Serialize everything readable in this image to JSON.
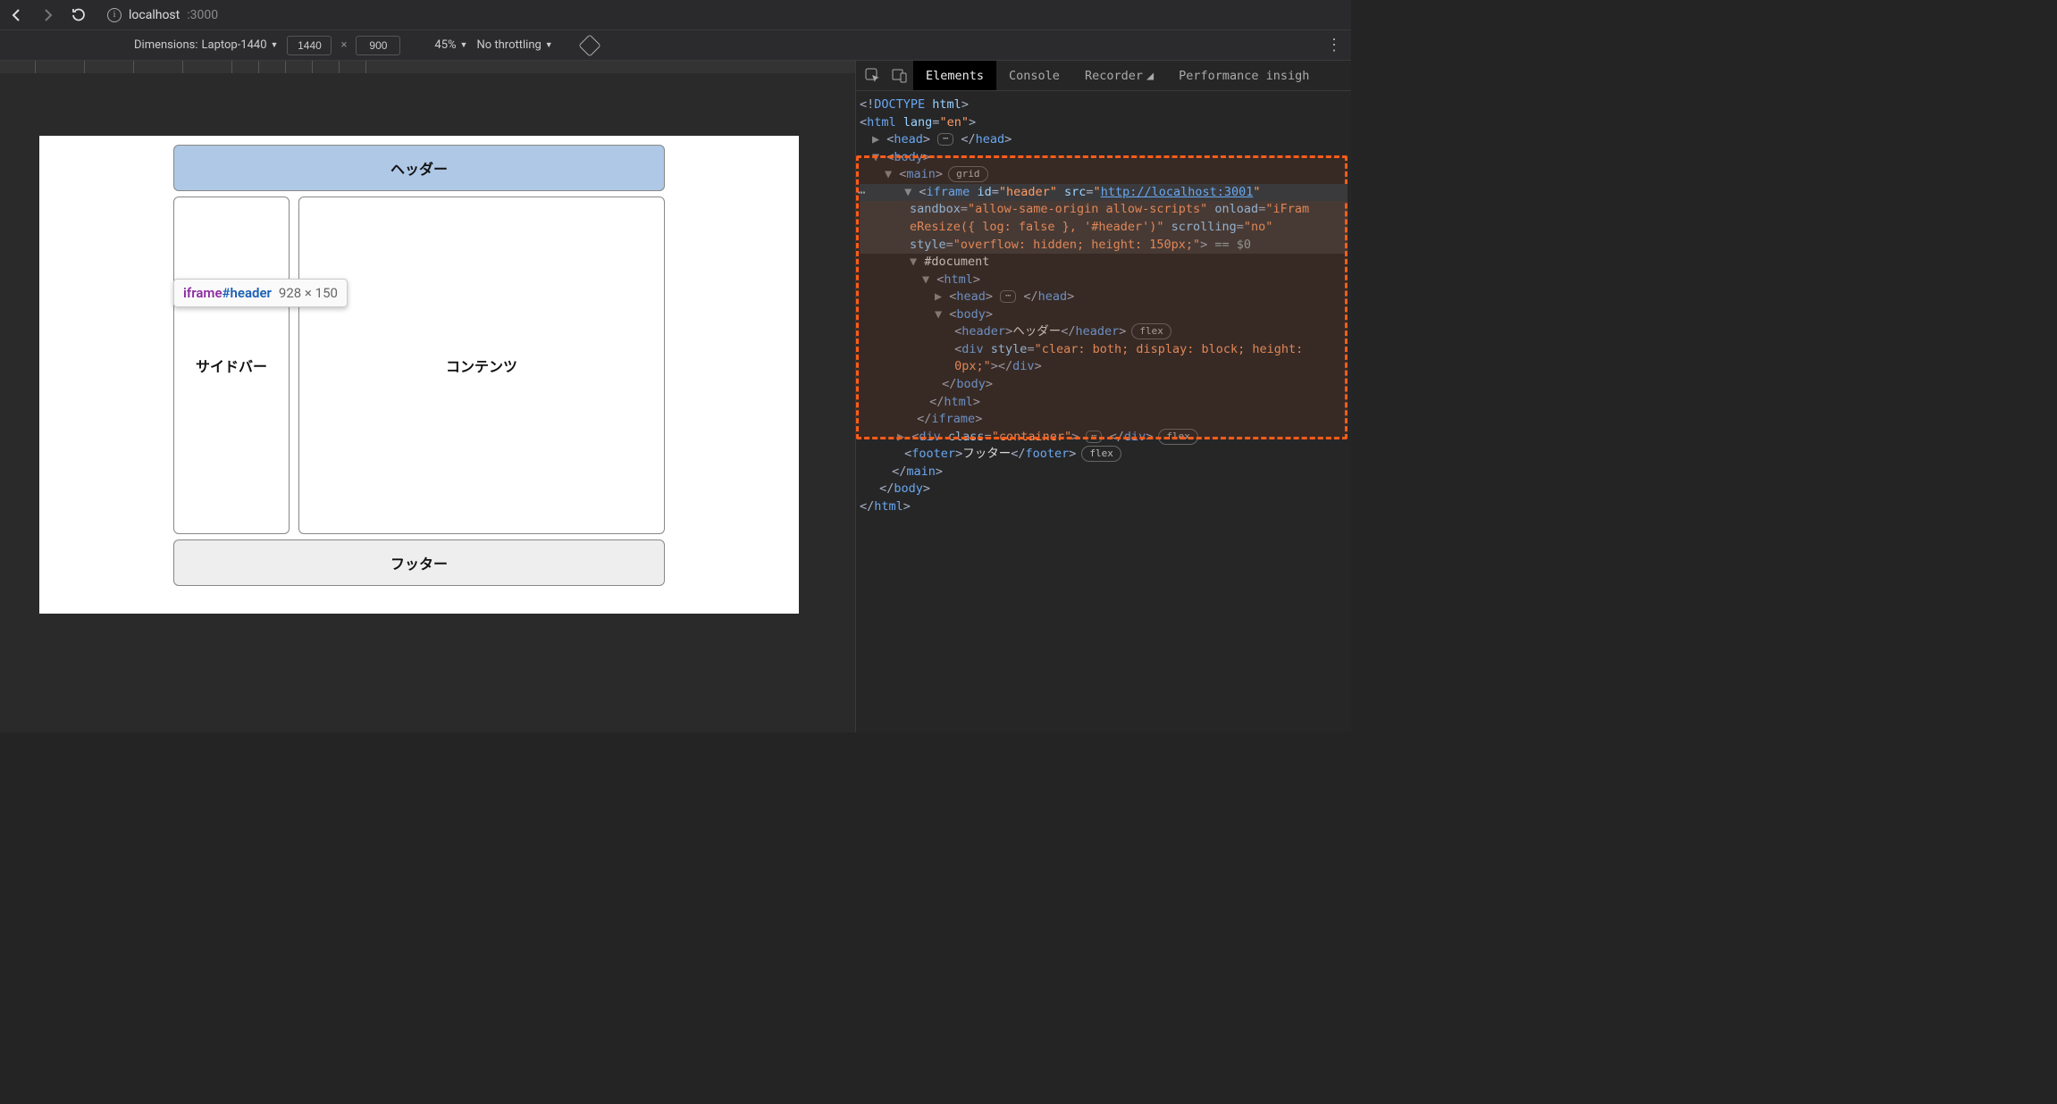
{
  "browser": {
    "url_host": "localhost",
    "url_port": ":3000"
  },
  "device_bar": {
    "dimensions_label": "Dimensions:",
    "device": "Laptop-1440",
    "width": "1440",
    "height": "900",
    "zoom": "45%",
    "throttling": "No throttling"
  },
  "page": {
    "header": "ヘッダー",
    "sidebar": "サイドバー",
    "content": "コンテンツ",
    "footer": "フッター"
  },
  "tooltip": {
    "tag": "iframe",
    "id": "#header",
    "dims": "928 × 150"
  },
  "devtools": {
    "tabs": {
      "elements": "Elements",
      "console": "Console",
      "recorder": "Recorder",
      "perf": "Performance insigh"
    },
    "dom": {
      "doctype": "<!DOCTYPE html>",
      "html_open": "<html lang=\"en\">",
      "head_collapsed": "<head> … </head>",
      "body_open": "<body>",
      "main_open": "<main>",
      "main_badge": "grid",
      "iframe_l1": "<iframe id=\"header\" src=\"",
      "iframe_src": "http://localhost:3001",
      "iframe_l1b": "\"",
      "iframe_l2": "sandbox=\"allow-same-origin allow-scripts\" onload=\"iFram",
      "iframe_l3": "eResize({ log: false }, '#header')\" scrolling=\"no\"",
      "iframe_l4": "style=\"overflow: hidden; height: 150px;\"> == $0",
      "docnode": "#document",
      "inner_html_open": "<html>",
      "inner_head": "<head> … </head>",
      "inner_body_open": "<body>",
      "inner_header": "<header>ヘッダー</header>",
      "inner_header_badge": "flex",
      "inner_div_l1": "<div style=\"clear: both; display: block; height:",
      "inner_div_l2": "0px;\"></div>",
      "inner_body_close": "</body>",
      "inner_html_close": "</html>",
      "iframe_close": "</iframe>",
      "container_div": "<div class=\"container\"> … </div>",
      "container_badge": "flex",
      "footer_node": "<footer>フッター</footer>",
      "footer_badge": "flex",
      "main_close": "</main>",
      "body_close": "</body>",
      "html_close": "</html>"
    }
  }
}
